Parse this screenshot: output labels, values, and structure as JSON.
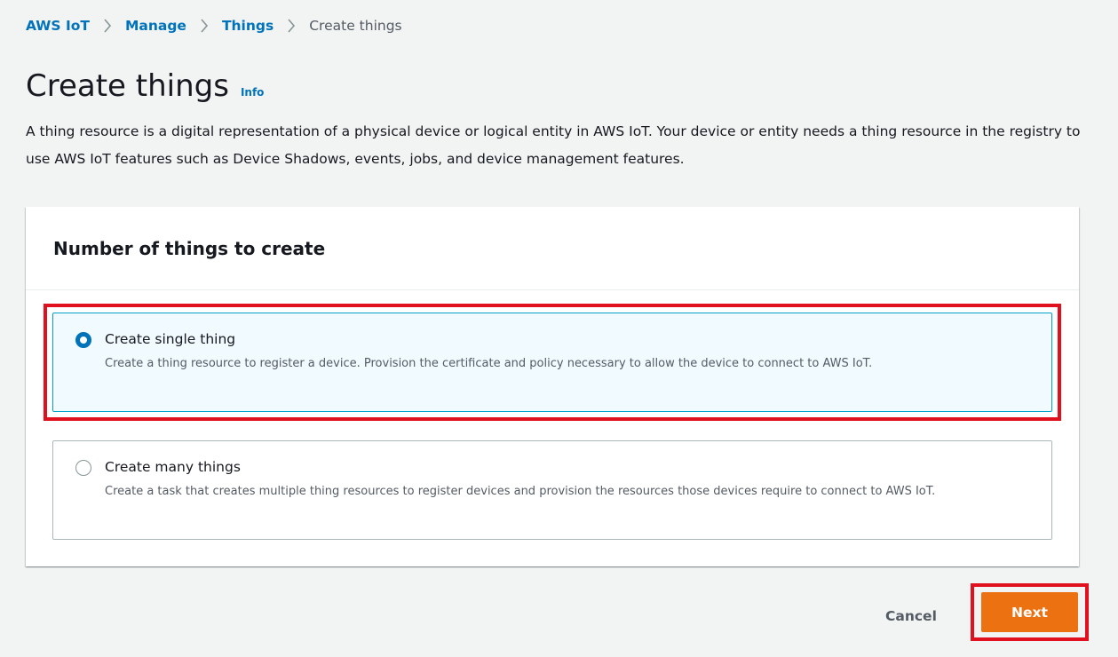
{
  "breadcrumb": {
    "items": [
      {
        "label": "AWS IoT"
      },
      {
        "label": "Manage"
      },
      {
        "label": "Things"
      },
      {
        "label": "Create things"
      }
    ],
    "separator": "chevron-right-icon"
  },
  "header": {
    "title": "Create things",
    "info_label": "Info",
    "description": "A thing resource is a digital representation of a physical device or logical entity in AWS IoT. Your device or entity needs a thing resource in the registry to use AWS IoT features such as Device Shadows, events, jobs, and device management features."
  },
  "panel": {
    "title": "Number of things to create",
    "options": [
      {
        "label": "Create single thing",
        "description": "Create a thing resource to register a device. Provision the certificate and policy necessary to allow the device to connect to AWS IoT.",
        "selected": true
      },
      {
        "label": "Create many things",
        "description": "Create a task that creates multiple thing resources to register devices and provision the resources those devices require to connect to AWS IoT.",
        "selected": false
      }
    ]
  },
  "actions": {
    "cancel_label": "Cancel",
    "next_label": "Next"
  },
  "colors": {
    "link": "#0073bb",
    "primary_button": "#ec7211",
    "highlight": "#e0101e",
    "selected_bg": "#f1faff",
    "page_bg": "#f2f3f3"
  }
}
